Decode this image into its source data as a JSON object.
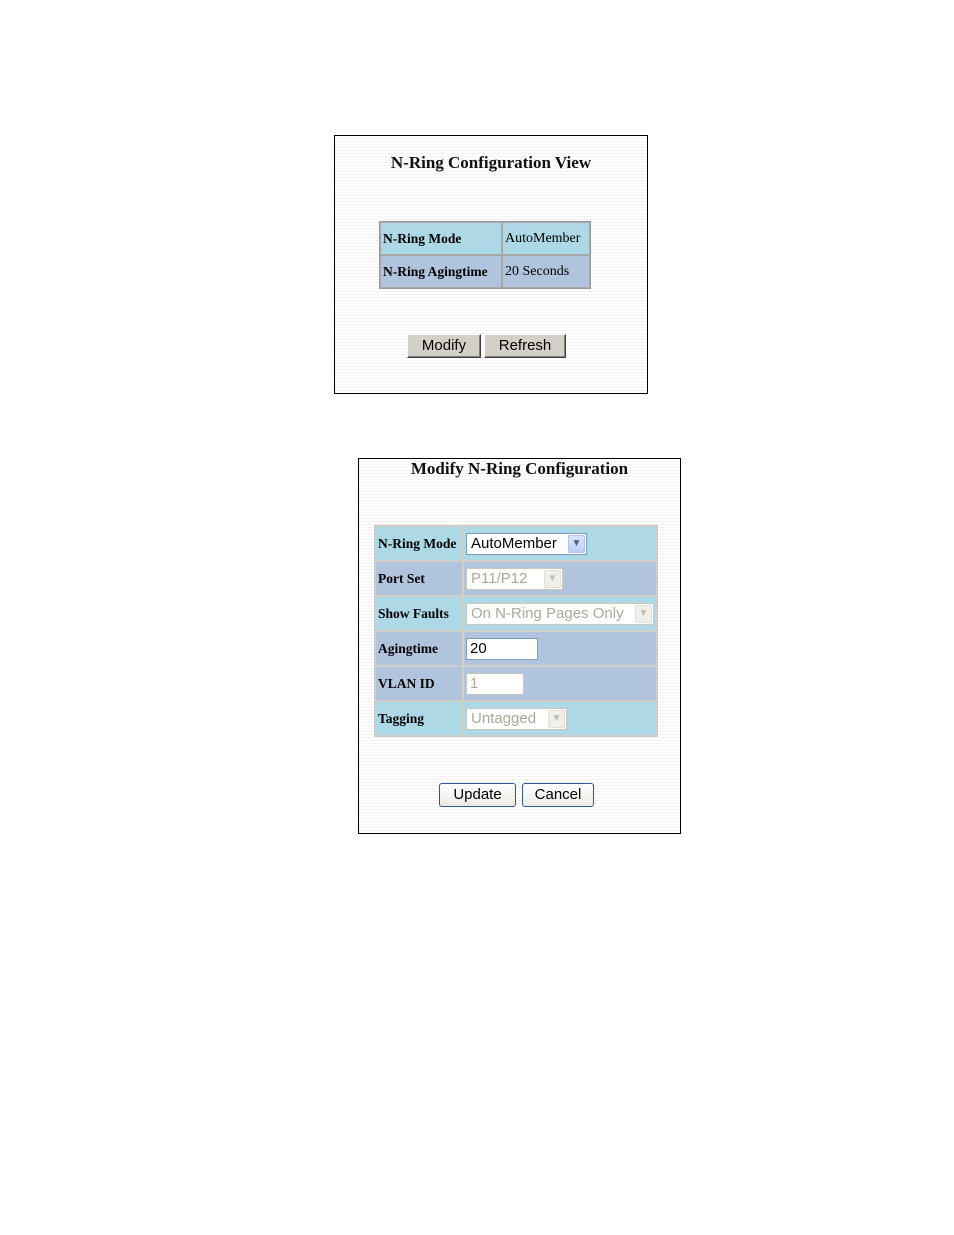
{
  "view": {
    "title": "N-Ring Configuration View",
    "rows": [
      {
        "label": "N-Ring Mode",
        "value": "AutoMember"
      },
      {
        "label": "N-Ring Agingtime",
        "value": "20 Seconds"
      }
    ],
    "modify_label": "Modify",
    "refresh_label": "Refresh"
  },
  "modify": {
    "title": "Modify N-Ring Configuration",
    "fields": {
      "mode": {
        "label": "N-Ring Mode",
        "value": "AutoMember"
      },
      "port_set": {
        "label": "Port Set",
        "value": "P11/P12"
      },
      "show_faults": {
        "label": "Show Faults",
        "value": "On N-Ring Pages Only"
      },
      "agingtime": {
        "label": "Agingtime",
        "value": "20"
      },
      "vlan_id": {
        "label": "VLAN ID",
        "value": "1"
      },
      "tagging": {
        "label": "Tagging",
        "value": "Untagged"
      }
    },
    "update_label": "Update",
    "cancel_label": "Cancel"
  },
  "icons": {
    "dropdown": "chevron-down-icon"
  }
}
